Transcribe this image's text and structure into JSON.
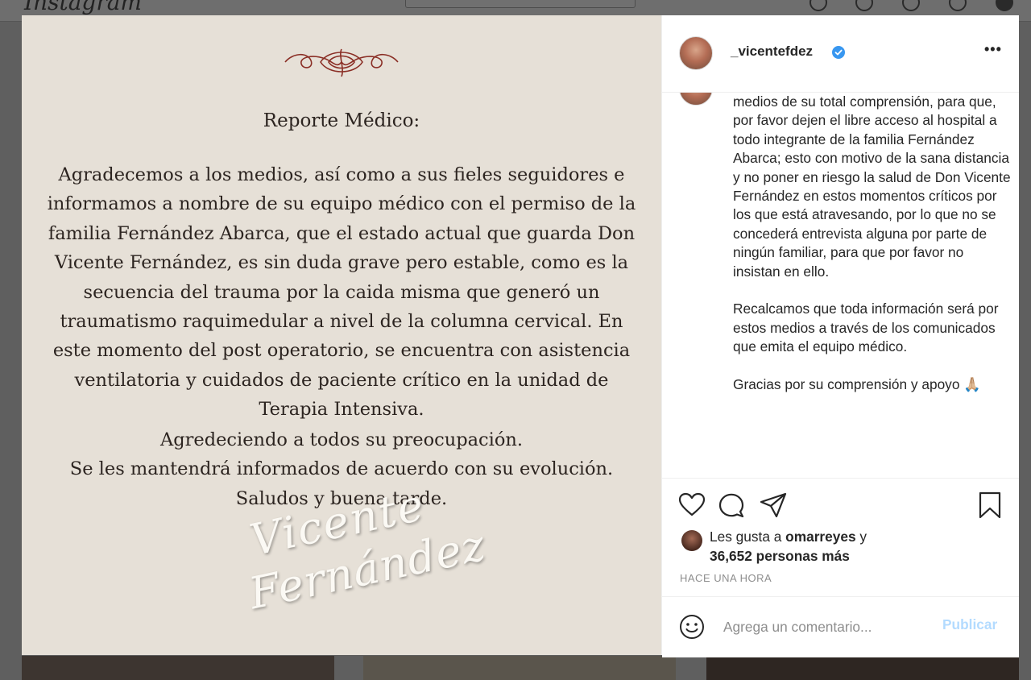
{
  "background_page": {
    "logo": "Instagram"
  },
  "post_image": {
    "title": "Reporte Médico:",
    "body": "Agradecemos a los medios, así como a sus fieles seguidores e informamos a nombre de su equipo médico con el permiso de la familia Fernández Abarca, que el estado actual que guarda Don Vicente Fernández, es sin duda grave pero estable, como es la secuencia del trauma por la caida misma que generó un traumatismo raquimedular a nivel de la columna cervical. En este momento del post operatorio, se encuentra con asistencia ventilatoria y cuidados de paciente crítico en la unidad de Terapia Intensiva.",
    "closing": [
      "Agredeciendo a todos su preocupación.",
      "Se les mantendrá informados de acuerdo con su evolución.",
      "Saludos y buena tarde."
    ],
    "signature": [
      "Vicente",
      "Fernández"
    ]
  },
  "post_header": {
    "username": "_vicentefdez",
    "verified_icon": "verified-badge-icon",
    "more_icon": "more-options-icon"
  },
  "caption": {
    "paragraphs": [
      "medios de su total comprensión, para que, por favor dejen el libre acceso al hospital a todo integrante de la familia Fernández Abarca; esto con motivo de la sana distancia y no poner en riesgo la salud de Don Vicente Fernández en estos momentos críticos por los que está atravesando, por lo que no se concederá entrevista alguna por parte de ningún familiar, para que por favor no insistan en ello.",
      "Recalcamos que toda información será por estos medios a través de los comunicados que emita el equipo médico.",
      "Gracias por su comprensión y apoyo 🙏🏼"
    ]
  },
  "actions": {
    "icons": [
      "heart-icon",
      "comment-icon",
      "share-icon",
      "bookmark-icon"
    ]
  },
  "likes": {
    "prefix": "Les gusta a ",
    "user": "omarreyes",
    "connector": " y",
    "count": "36,652 personas más"
  },
  "timestamp": "HACE UNA HORA",
  "comment": {
    "placeholder": "Agrega un comentario...",
    "publish_label": "Publicar"
  },
  "colors": {
    "post_background": "#e6e0d7",
    "publish_disabled": "#b3dbff",
    "verified_blue": "#3897f0",
    "text_main": "#262626",
    "text_muted": "#8e8e8e"
  }
}
